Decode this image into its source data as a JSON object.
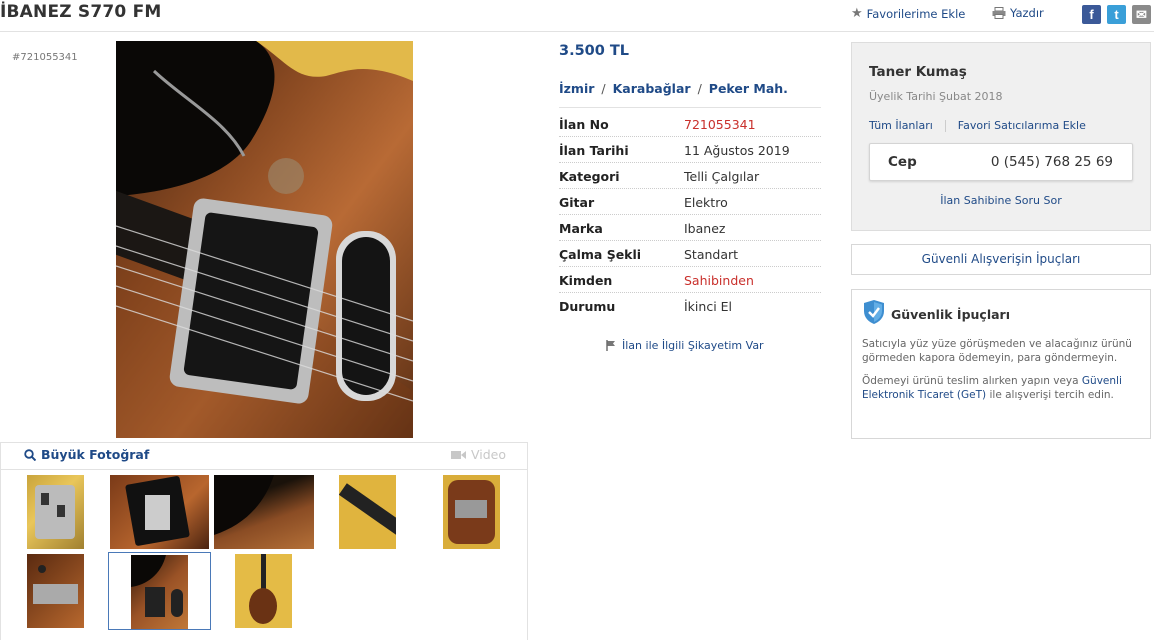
{
  "listing": {
    "title": "İBANEZ S770 FM",
    "ad_number_label": "#721055341"
  },
  "actions": {
    "favorites": "Favorilerime Ekle",
    "print": "Yazdır",
    "facebook": "f",
    "twitter": "t",
    "mail": "✉"
  },
  "gallery": {
    "big_photo": "Büyük Fotoğraf",
    "video": "Video",
    "selected_thumbnail_index": 6
  },
  "details": {
    "price": "3.500 TL",
    "location": [
      "İzmir",
      "Karabağlar",
      "Peker Mah."
    ],
    "location_separator": "/",
    "rows": [
      {
        "key": "İlan No",
        "value": "721055341"
      },
      {
        "key": "İlan Tarihi",
        "value": "11 Ağustos 2019"
      },
      {
        "key": "Kategori",
        "value": "Telli Çalgılar"
      },
      {
        "key": "Gitar",
        "value": "Elektro"
      },
      {
        "key": "Marka",
        "value": "Ibanez"
      },
      {
        "key": "Çalma Şekli",
        "value": "Standart"
      },
      {
        "key": "Kimden",
        "value": "Sahibinden"
      },
      {
        "key": "Durumu",
        "value": "İkinci El"
      }
    ],
    "complaint": "İlan ile İlgili Şikayetim Var"
  },
  "seller": {
    "name": "Taner Kumaş",
    "member_since": "Üyelik Tarihi  Şubat 2018",
    "all_ads": "Tüm İlanları",
    "add_favorite_seller": "Favori Satıcılarıma Ekle",
    "phone_label": "Cep",
    "phone": "0 (545) 768 25 69",
    "ask_question": "İlan Sahibine Soru Sor"
  },
  "tips": {
    "button": "Güvenli Alışverişin İpuçları",
    "security_title": "Güvenlik İpuçları",
    "text1": "Satıcıyla yüz yüze görüşmeden ve alacağınız ürünü görmeden kapora ödemeyin, para göndermeyin.",
    "text2_pre": "Ödemeyi ürünü teslim alırken yapın veya",
    "text2_link": "Güvenli Elektronik Ticaret (GeT)",
    "text2_post": "ile alışverişi tercih edin."
  },
  "colors": {
    "link": "#1f4a87",
    "red_value": "#c9302c",
    "facebook": "#3b5998",
    "twitter": "#3a9fd8"
  }
}
